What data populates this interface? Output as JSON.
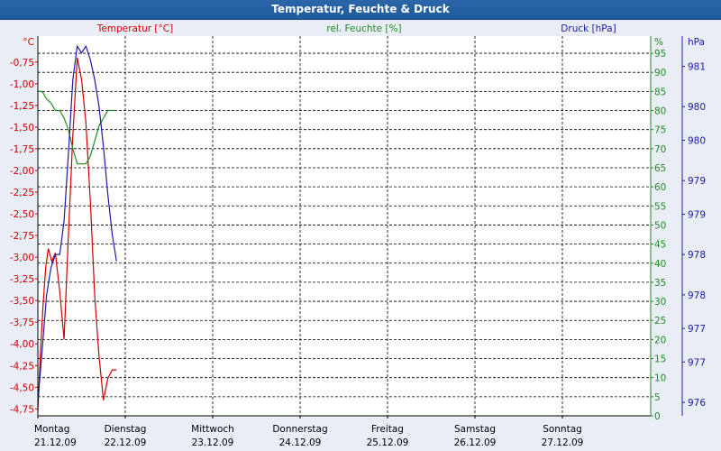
{
  "window": {
    "title": "Temperatur, Feuchte & Druck"
  },
  "colors": {
    "temperature": "#cc0000",
    "humidity": "#228b22",
    "pressure": "#1a1aa8",
    "axis_text": "#000000"
  },
  "chart_data": {
    "type": "line",
    "title": "Temperatur, Feuchte & Druck",
    "grid": true,
    "legend": "none",
    "x_ticks": [
      {
        "day": "Montag",
        "date": "21.12.09"
      },
      {
        "day": "Dienstag",
        "date": "22.12.09"
      },
      {
        "day": "Mittwoch",
        "date": "23.12.09"
      },
      {
        "day": "Donnerstag",
        "date": "24.12.09"
      },
      {
        "day": "Freitag",
        "date": "25.12.09"
      },
      {
        "day": "Samstag",
        "date": "26.12.09"
      },
      {
        "day": "Sonntag",
        "date": "27.12.09"
      }
    ],
    "xlim": [
      0,
      7
    ],
    "axes": {
      "left": {
        "label": "Temperatur [°C]",
        "unit": "°C",
        "ylim": [
          -4.83,
          -0.45
        ],
        "ticks": [
          "-0,75",
          "-1,00",
          "-1,25",
          "-1,50",
          "-1,75",
          "-2,00",
          "-2,25",
          "-2,50",
          "-2,75",
          "-3,00",
          "-3,25",
          "-3,50",
          "-3,75",
          "-4,00",
          "-4,25",
          "-4,50",
          "-4,75"
        ],
        "tick_values": [
          -0.75,
          -1.0,
          -1.25,
          -1.5,
          -1.75,
          -2.0,
          -2.25,
          -2.5,
          -2.75,
          -3.0,
          -3.25,
          -3.5,
          -3.75,
          -4.0,
          -4.25,
          -4.5,
          -4.75
        ]
      },
      "mid": {
        "label": "rel. Feuchte [%]",
        "unit": "%",
        "ylim": [
          0,
          99.5
        ],
        "ticks": [
          "95",
          "90",
          "85",
          "80",
          "75",
          "70",
          "65",
          "60",
          "55",
          "50",
          "45",
          "40",
          "35",
          "30",
          "25",
          "20",
          "15",
          "10",
          "5",
          "0"
        ],
        "tick_values": [
          95,
          90,
          85,
          80,
          75,
          70,
          65,
          60,
          55,
          50,
          45,
          40,
          35,
          30,
          25,
          20,
          15,
          10,
          5,
          0
        ]
      },
      "right": {
        "label": "Druck [hPa]",
        "unit": "hPa",
        "ylim": [
          975.8,
          981.45
        ],
        "ticks": [
          "981",
          "980",
          "980",
          "979",
          "979",
          "978",
          "978",
          "977",
          "977",
          "976"
        ],
        "tick_values": [
          981.0,
          980.4,
          979.9,
          979.3,
          978.8,
          978.2,
          977.6,
          977.1,
          976.6,
          976.0
        ]
      }
    },
    "series": [
      {
        "name": "Temperatur [°C]",
        "axis": "left",
        "color": "#cc0000",
        "x": [
          0.0,
          0.03,
          0.06,
          0.09,
          0.12,
          0.16,
          0.2,
          0.25,
          0.3,
          0.35,
          0.4,
          0.45,
          0.5,
          0.55,
          0.6,
          0.65,
          0.7,
          0.75,
          0.8,
          0.85,
          0.9
        ],
        "y": [
          -4.78,
          -4.1,
          -3.55,
          -3.12,
          -2.9,
          -3.05,
          -2.95,
          -3.4,
          -3.95,
          -2.75,
          -1.6,
          -0.7,
          -0.95,
          -1.45,
          -2.35,
          -3.45,
          -4.15,
          -4.65,
          -4.4,
          -4.3,
          -4.3
        ]
      },
      {
        "name": "rel. Feuchte [%]",
        "axis": "mid",
        "color": "#228b22",
        "x": [
          0.0,
          0.05,
          0.1,
          0.15,
          0.2,
          0.25,
          0.3,
          0.35,
          0.4,
          0.45,
          0.5,
          0.55,
          0.6,
          0.65,
          0.7,
          0.75,
          0.8,
          0.85,
          0.9
        ],
        "y": [
          85,
          85,
          83,
          82,
          80,
          80,
          78,
          75,
          70,
          66,
          66,
          66,
          68,
          72,
          76,
          78,
          80,
          80,
          80
        ]
      },
      {
        "name": "Druck [hPa]",
        "axis": "right",
        "color": "#1a1aa8",
        "x": [
          0.0,
          0.05,
          0.1,
          0.15,
          0.2,
          0.25,
          0.3,
          0.35,
          0.4,
          0.45,
          0.5,
          0.55,
          0.6,
          0.65,
          0.7,
          0.75,
          0.8,
          0.85,
          0.9
        ],
        "y": [
          976.0,
          976.8,
          977.6,
          978.0,
          978.2,
          978.2,
          978.7,
          979.7,
          980.8,
          981.3,
          981.2,
          981.3,
          981.1,
          980.8,
          980.4,
          979.8,
          979.1,
          978.5,
          978.1
        ]
      }
    ]
  }
}
